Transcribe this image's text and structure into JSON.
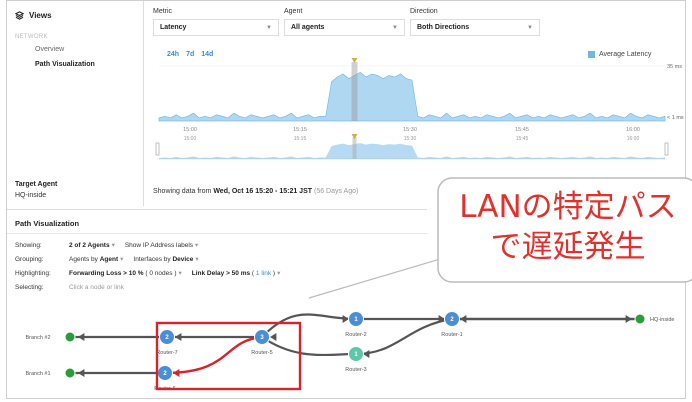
{
  "sidebar": {
    "views_label": "Views",
    "section": "NETWORK",
    "items": [
      {
        "label": "Overview"
      },
      {
        "label": "Path Visualization"
      }
    ],
    "target_agent_title": "Target Agent",
    "target_agent_value": "HQ-inside"
  },
  "filters": {
    "metric": {
      "label": "Metric",
      "value": "Latency"
    },
    "agent": {
      "label": "Agent",
      "value": "All agents"
    },
    "direction": {
      "label": "Direction",
      "value": "Both Directions"
    }
  },
  "chart": {
    "ranges": [
      "24h",
      "7d",
      "14d"
    ],
    "legend": "Average Latency",
    "y_top_label": "35 ms",
    "y_bottom_label": "< 1 ms",
    "series_color": "#6db6e8"
  },
  "chart_data": {
    "type": "area",
    "x": [
      "15:00",
      "15:15",
      "15:30",
      "15:45",
      "16:00"
    ],
    "values": [
      2,
      3,
      2,
      4,
      2,
      3,
      5,
      2,
      3,
      2,
      4,
      3,
      2,
      5,
      3,
      2,
      4,
      3,
      2,
      3,
      4,
      2,
      3,
      5,
      2,
      3,
      4,
      2,
      3,
      3,
      25,
      28,
      30,
      27,
      29,
      31,
      28,
      30,
      29,
      27,
      29,
      28,
      30,
      27,
      26,
      3,
      2,
      4,
      3,
      2,
      5,
      2,
      3,
      4,
      2,
      3,
      2,
      4,
      3,
      2,
      3,
      5,
      2,
      3,
      4,
      2,
      3,
      2,
      4,
      3,
      2,
      3,
      4,
      2,
      3,
      5,
      2,
      3,
      2,
      4,
      3,
      2,
      5,
      3,
      2,
      4,
      3,
      2,
      3
    ],
    "ylabel": "",
    "ylim": [
      0,
      35
    ]
  },
  "showing": {
    "prefix": "Showing data from",
    "range": "Wed, Oct 16 15:20 - 15:21 JST",
    "ago": "(56 Days Ago)"
  },
  "path_vis": {
    "title": "Path Visualization",
    "showing_label": "Showing:",
    "showing_value": "2 of 2 Agents",
    "showing_option": "Show IP Address labels",
    "grouping_label": "Grouping:",
    "grouping_agents_prefix": "Agents by",
    "grouping_agents_value": "Agent",
    "grouping_interfaces_prefix": "Interfaces by",
    "grouping_interfaces_value": "Device",
    "highlighting_label": "Highlighting:",
    "highlight_loss": "Forwarding Loss > 10 %",
    "highlight_loss_count": "( 0 nodes )",
    "highlight_delay": "Link Delay > 50 ms",
    "highlight_delay_open": "(",
    "highlight_delay_link": "1 link",
    "highlight_delay_close": ")",
    "selecting_label": "Selecting:",
    "selecting_value": "Click a node or link"
  },
  "graph": {
    "nodes": [
      {
        "id": "branch2",
        "label": "Branch #2",
        "num": ""
      },
      {
        "id": "branch1",
        "label": "Branch #1",
        "num": ""
      },
      {
        "id": "router7",
        "label": "Router-7",
        "num": "2"
      },
      {
        "id": "router6",
        "label": "Router-6",
        "num": "2"
      },
      {
        "id": "router5",
        "label": "Router-5",
        "num": "3"
      },
      {
        "id": "router2",
        "label": "Router-2",
        "num": "1"
      },
      {
        "id": "router3",
        "label": "Router-3",
        "num": "1"
      },
      {
        "id": "router1",
        "label": "Router-1",
        "num": "2"
      },
      {
        "id": "hq",
        "label": "HQ-inside",
        "num": ""
      }
    ],
    "agent_color": "#2a9d3a",
    "router_color": "#4a8fd6",
    "router3_color": "#5cc8a8",
    "highlight_color": "#d8232a"
  },
  "callout": {
    "line1": "LANの特定パス",
    "line2": "で遅延発生"
  }
}
